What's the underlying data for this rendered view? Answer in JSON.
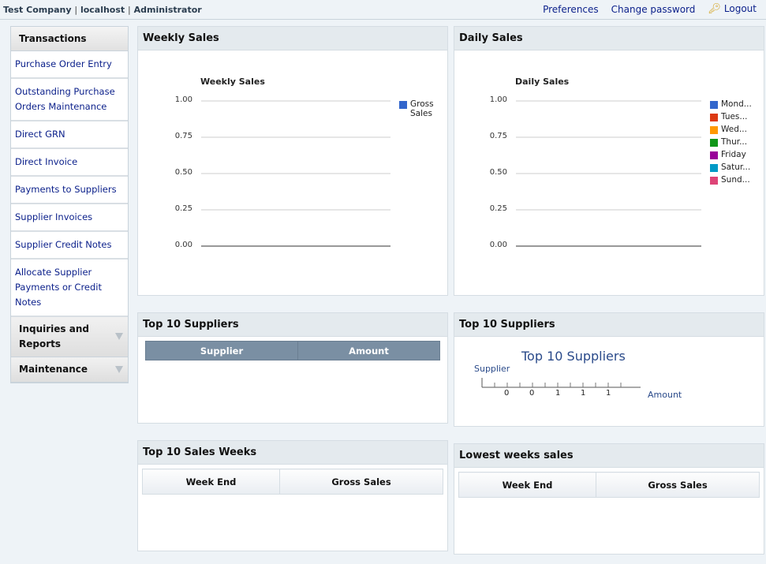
{
  "topbar": {
    "company": "Test Company",
    "host": "localhost",
    "user": "Administrator",
    "sep": "|",
    "preferences": "Preferences",
    "change_password": "Change password",
    "logout": "Logout",
    "logout_icon": "key-icon"
  },
  "sidebar": {
    "header": "Transactions",
    "items": [
      {
        "label": "Purchase Order Entry"
      },
      {
        "label": "Outstanding Purchase Orders Maintenance"
      },
      {
        "label": "Direct GRN"
      },
      {
        "label": "Direct Invoice"
      },
      {
        "label": "Payments to Suppliers"
      },
      {
        "label": "Supplier Invoices"
      },
      {
        "label": "Supplier Credit Notes"
      },
      {
        "label": "Allocate Supplier Payments or Credit Notes"
      }
    ],
    "sections": [
      {
        "label": "Inquiries and Reports"
      },
      {
        "label": "Maintenance"
      }
    ]
  },
  "panels": {
    "weekly": {
      "title": "Weekly Sales"
    },
    "daily": {
      "title": "Daily Sales"
    },
    "top_suppliers_table": {
      "title": "Top 10 Suppliers",
      "col1": "Supplier",
      "col2": "Amount"
    },
    "top_suppliers_chart": {
      "title": "Top 10 Suppliers"
    },
    "top_weeks": {
      "title": "Top 10 Sales Weeks",
      "col1": "Week End",
      "col2": "Gross Sales"
    },
    "lowest_weeks": {
      "title": "Lowest weeks sales",
      "col1": "Week End",
      "col2": "Gross Sales"
    }
  },
  "chart_data": [
    {
      "type": "line",
      "title": "Weekly Sales",
      "ylim": [
        0,
        1
      ],
      "yticks": [
        "1.00",
        "0.75",
        "0.50",
        "0.25",
        "0.00"
      ],
      "series": [
        {
          "name": "Gross Sales",
          "values": [],
          "color": "#3366cc"
        }
      ],
      "legend": "right"
    },
    {
      "type": "line",
      "title": "Daily Sales",
      "ylim": [
        0,
        1
      ],
      "yticks": [
        "1.00",
        "0.75",
        "0.50",
        "0.25",
        "0.00"
      ],
      "series": [
        {
          "name": "Mond...",
          "values": [],
          "color": "#3366cc"
        },
        {
          "name": "Tues...",
          "values": [],
          "color": "#dc3912"
        },
        {
          "name": "Wed...",
          "values": [],
          "color": "#ff9900"
        },
        {
          "name": "Thur...",
          "values": [],
          "color": "#109618"
        },
        {
          "name": "Friday",
          "values": [],
          "color": "#990099"
        },
        {
          "name": "Satur...",
          "values": [],
          "color": "#0099c6"
        },
        {
          "name": "Sund...",
          "values": [],
          "color": "#dd4477"
        }
      ],
      "legend": "right"
    },
    {
      "type": "bar",
      "title": "Top 10 Suppliers",
      "ylabel": "Supplier",
      "xlabel": "Amount",
      "xticks": [
        "0",
        "0",
        "1",
        "1",
        "1"
      ],
      "series": []
    }
  ]
}
